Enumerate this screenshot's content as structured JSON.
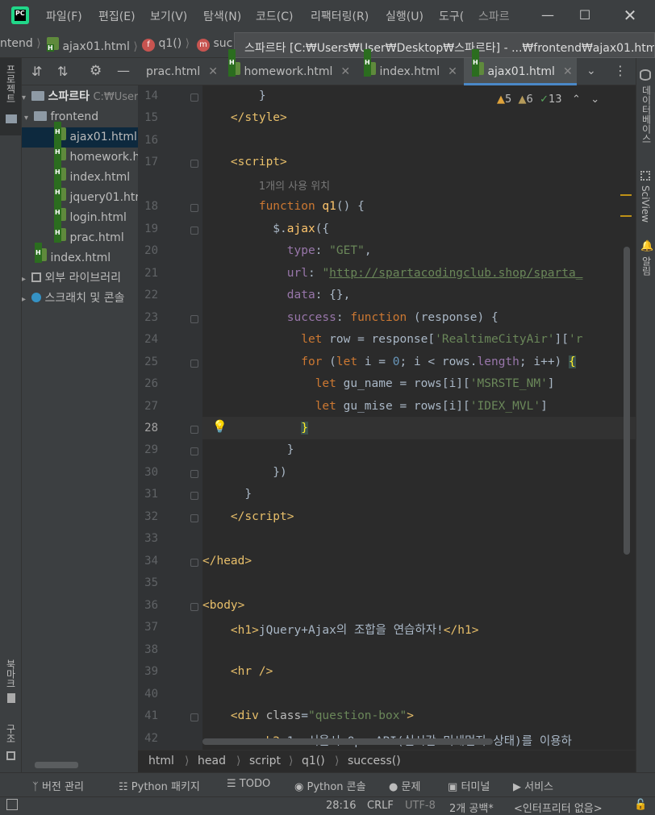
{
  "titlebar": {
    "logo_text": "PC",
    "menus": [
      "파일(F)",
      "편집(E)",
      "보기(V)",
      "탐색(N)",
      "코드(C)",
      "리팩터링(R)",
      "실행(U)",
      "도구("
    ],
    "project_short": "스파르"
  },
  "navbar": {
    "crumbs": [
      "ntend",
      "ajax01.html",
      "q1()",
      "suc"
    ],
    "tooltip": "스파르타 [C:₩Users₩User₩Desktop₩스파르타] - ...₩frontend₩ajax01.html"
  },
  "left_stripe": {
    "project_label": "프로젝트",
    "bookmark_label": "북마크",
    "structure_label": "구조"
  },
  "project_tree": [
    {
      "label": "스파르타",
      "suffix": "C:₩Users",
      "type": "root"
    },
    {
      "label": "frontend",
      "type": "folder"
    },
    {
      "label": "ajax01.html",
      "type": "file",
      "selected": true
    },
    {
      "label": "homework.h",
      "type": "file"
    },
    {
      "label": "index.html",
      "type": "file"
    },
    {
      "label": "jquery01.htr",
      "type": "file"
    },
    {
      "label": "login.html",
      "type": "file"
    },
    {
      "label": "prac.html",
      "type": "file"
    },
    {
      "label": "index.html",
      "type": "file-root"
    },
    {
      "label": "외부 라이브러리",
      "type": "lib"
    },
    {
      "label": "스크래치 및 콘솔",
      "type": "scratch"
    }
  ],
  "tabs": [
    {
      "label": "prac.html",
      "active": false
    },
    {
      "label": "homework.html",
      "active": false
    },
    {
      "label": "index.html",
      "active": false
    },
    {
      "label": "ajax01.html",
      "active": true
    }
  ],
  "right_stripe": {
    "database_label": "데이터베이스",
    "sciview_label": "SciView",
    "notifications_label": "알림"
  },
  "inspections": {
    "warnings": "5",
    "weak_warnings": "6",
    "typos": "13"
  },
  "editor": {
    "current_line": "28",
    "usage_hint": "1개의 사용 위치",
    "line_numbers": [
      "14",
      "15",
      "16",
      "17",
      "18",
      "19",
      "20",
      "21",
      "22",
      "23",
      "24",
      "25",
      "26",
      "27",
      "28",
      "29",
      "30",
      "31",
      "32",
      "33",
      "34",
      "35",
      "36",
      "37",
      "38",
      "39",
      "40",
      "41",
      "42"
    ]
  },
  "code_breadcrumb": [
    "html",
    "head",
    "script",
    "q1()",
    "success()"
  ],
  "tool_windows": [
    "버전 관리",
    "Python 패키지",
    "TODO",
    "Python 콘솔",
    "문제",
    "터미널",
    "서비스"
  ],
  "status": {
    "position": "28:16",
    "line_ending": "CRLF",
    "encoding": "UTF-8",
    "indent": "2개 공백*",
    "interpreter": "<인터프리터 없음>"
  }
}
